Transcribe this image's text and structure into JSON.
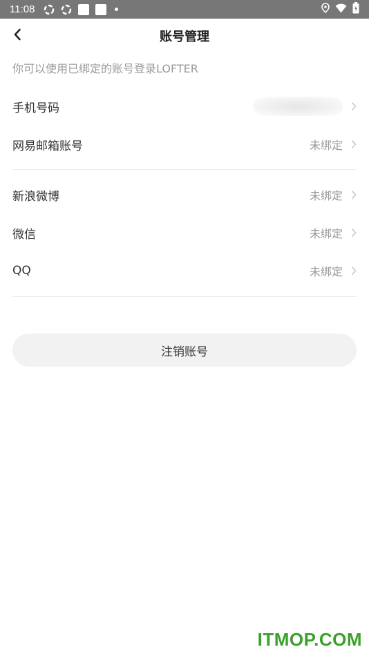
{
  "status_bar": {
    "time": "11:08",
    "icons": [
      "sync-icon",
      "sync-icon",
      "notification-square-icon",
      "notification-square-icon",
      "dot-icon"
    ],
    "right_icons": [
      "location-icon",
      "wifi-icon",
      "battery-icon"
    ]
  },
  "header": {
    "title": "账号管理",
    "back_icon": "chevron-left-icon"
  },
  "hint": "你可以使用已绑定的账号登录LOFTER",
  "accounts_group1": [
    {
      "label": "手机号码",
      "value": ""
    },
    {
      "label": "网易邮箱账号",
      "value": "未绑定"
    }
  ],
  "accounts_group2": [
    {
      "label": "新浪微博",
      "value": "未绑定"
    },
    {
      "label": "微信",
      "value": "未绑定"
    },
    {
      "label": "QQ",
      "value": "未绑定"
    }
  ],
  "logout_button": "注销账号",
  "watermark": "ITMOP.COM",
  "colors": {
    "status_bar": "#777777",
    "muted_text": "#9a9a9a",
    "button_bg": "#f2f2f2",
    "watermark": "#3aa12a"
  }
}
